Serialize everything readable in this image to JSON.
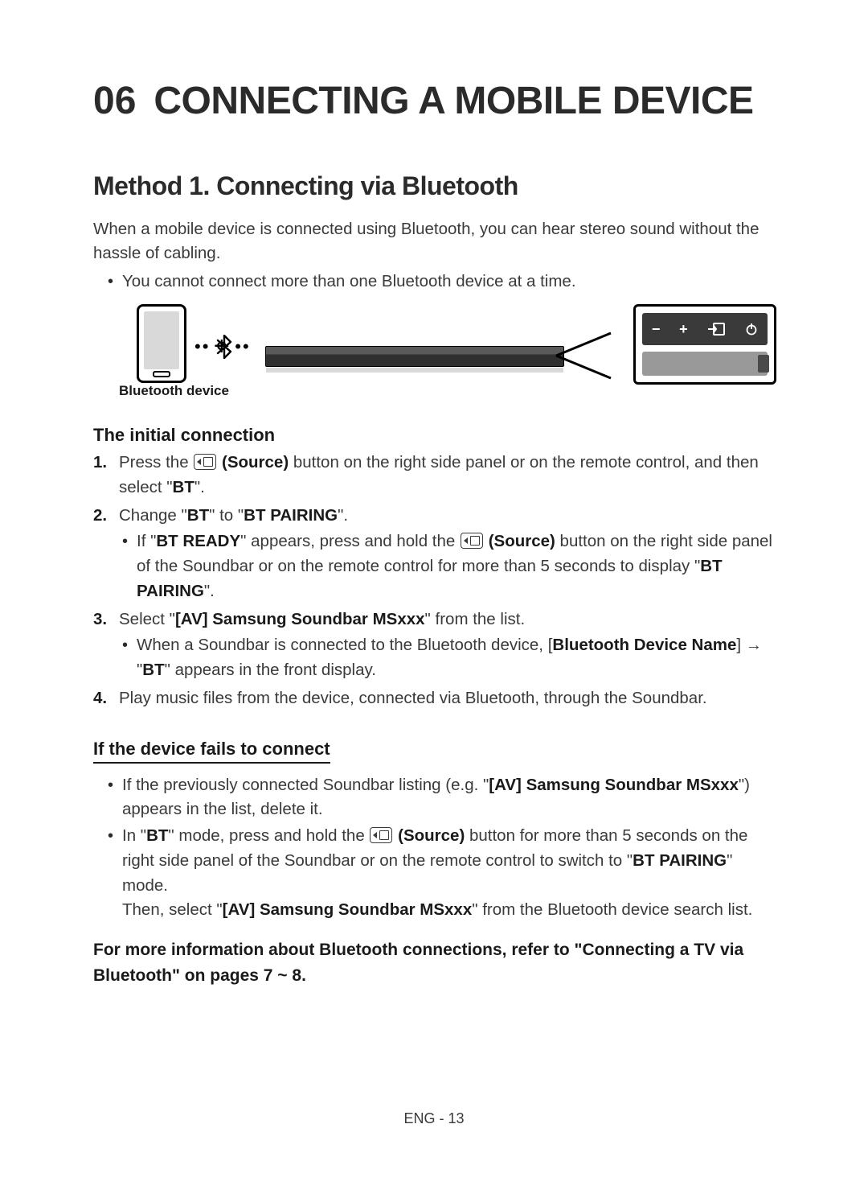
{
  "chapter": {
    "number": "06",
    "title": "CONNECTING A MOBILE DEVICE"
  },
  "method1": {
    "heading": "Method 1. Connecting via Bluetooth",
    "intro": "When a mobile device is connected using Bluetooth, you can hear stereo sound without the hassle of cabling.",
    "limit": "You cannot connect more than one Bluetooth device at a time.",
    "diagram_caption": "Bluetooth device",
    "panel_buttons": {
      "minus": "−",
      "plus": "+",
      "source": "↲",
      "power": "⏻"
    },
    "initial": {
      "heading": "The initial connection",
      "step1_a": "Press the ",
      "step1_source": "(Source)",
      "step1_b": " button on the right side panel or on the remote control, and then select \"",
      "step1_bt": "BT",
      "step1_c": "\".",
      "step2_a": "Change \"",
      "step2_bt": "BT",
      "step2_b": "\" to \"",
      "step2_pairing": "BT PAIRING",
      "step2_c": "\".",
      "step2_sub_a": "If \"",
      "step2_sub_ready": "BT READY",
      "step2_sub_b": "\" appears, press and hold the ",
      "step2_sub_source": "(Source)",
      "step2_sub_c": " button on the right side panel of the Soundbar or on the remote control for more than 5 seconds to display \"",
      "step2_sub_pairing": "BT PAIRING",
      "step2_sub_d": "\".",
      "step3_a": "Select \"",
      "step3_name": "[AV] Samsung Soundbar MSxxx",
      "step3_b": "\" from the list.",
      "step3_sub_a": "When a Soundbar is connected to the Bluetooth device, [",
      "step3_sub_bdn": "Bluetooth Device Name",
      "step3_sub_b": "] → \"",
      "step3_sub_bt": "BT",
      "step3_sub_c": "\" appears in the front display.",
      "step4": "Play music files from the device, connected via Bluetooth, through the Soundbar."
    },
    "fails": {
      "heading": "If the device fails to connect",
      "b1_a": "If the previously connected Soundbar listing (e.g. \"",
      "b1_name": "[AV] Samsung Soundbar MSxxx",
      "b1_b": "\") appears in the list, delete it.",
      "b2_a": "In \"",
      "b2_bt": "BT",
      "b2_b": "\" mode, press and hold the ",
      "b2_source": "(Source)",
      "b2_c": " button for more than 5 seconds on the right side panel of the Soundbar or on the remote control to switch to \"",
      "b2_pairing": "BT PAIRING",
      "b2_d": "\" mode.",
      "b2_then_a": "Then, select \"",
      "b2_then_name": "[AV] Samsung Soundbar MSxxx",
      "b2_then_b": "\" from the Bluetooth device search list."
    },
    "more_info": "For more information about Bluetooth connections, refer to \"Connecting a TV via Bluetooth\" on pages 7 ~ 8."
  },
  "footer": "ENG - 13"
}
